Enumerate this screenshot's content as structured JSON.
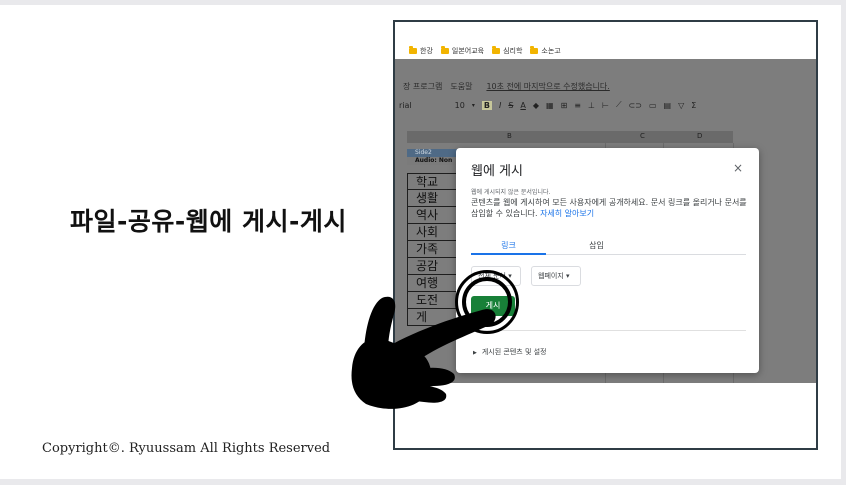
{
  "caption": "파일-공유-웹에 게시-게시",
  "copyright": "Copyright©. Ryuussam All Rights Reserved",
  "bookmarks": [
    {
      "label": "한강",
      "icon": "folder-icon"
    },
    {
      "label": "일본어교육",
      "icon": "folder-icon"
    },
    {
      "label": "심리학",
      "icon": "folder-icon"
    },
    {
      "label": "소논고",
      "icon": "folder-icon"
    }
  ],
  "menu": {
    "items": [
      "장 프로그램",
      "도움말"
    ],
    "saved": "10초 전에 마지막으로 수정했습니다."
  },
  "toolbar": {
    "font": "rial",
    "size": "10",
    "bold": "B",
    "italic": "I",
    "strike": "S",
    "underline": "A"
  },
  "columns": [
    "B",
    "C",
    "D"
  ],
  "sheet": {
    "top1": "Side2",
    "top2": "Audio: Non",
    "cells": [
      "학교",
      "생활",
      "역사",
      "사회",
      "가족",
      "공감",
      "여행",
      "도전",
      "게"
    ]
  },
  "dialog": {
    "title": "웹에 게시",
    "close": "×",
    "subtitle": "웹에 게시되지 않은 문서입니다.",
    "description": "콘텐츠를 웹에 게시하여 모든 사용자에게 공개하세요. 문서 링크를 올리거나 문서를 삽입할 수 있습니다.",
    "learn_more": "자세히 알아보기",
    "tabs": [
      "링크",
      "삽입"
    ],
    "select1": "전체 문서 ▾",
    "select2": "웹페이지 ▾",
    "publish": "게시",
    "expander": "게시된 콘텐츠 및 설정"
  },
  "colors": {
    "accent": "#1a73e8",
    "publish": "#188038",
    "frame": "#2f3c45"
  }
}
